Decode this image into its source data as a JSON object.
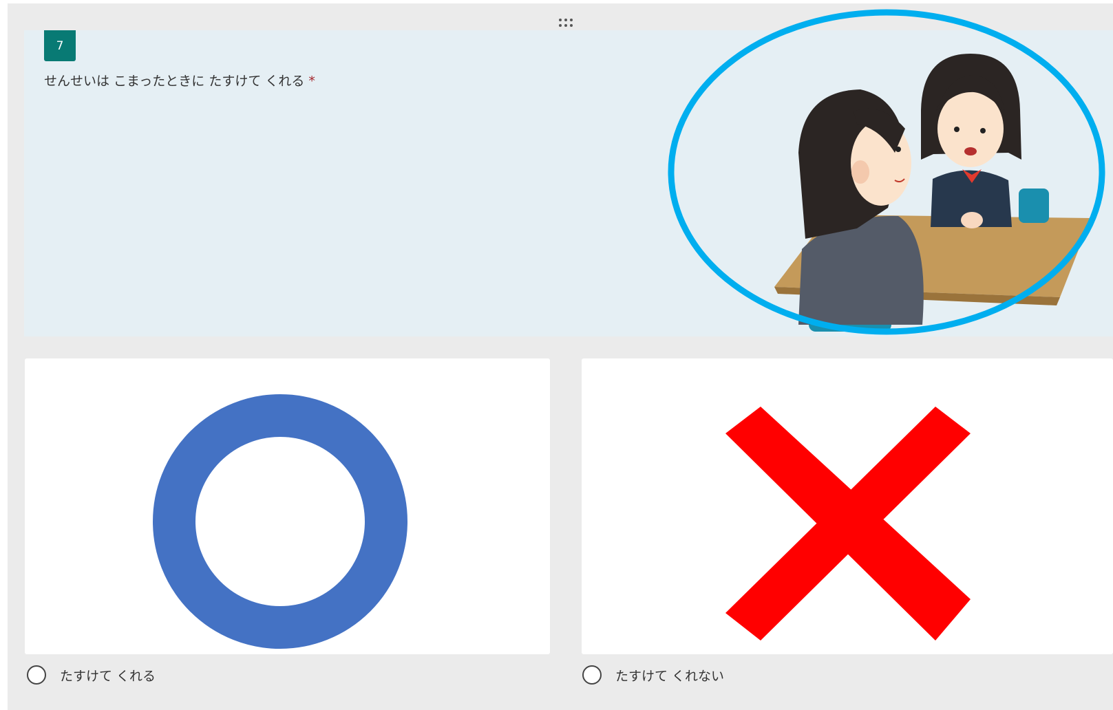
{
  "question": {
    "number": "7",
    "title": "せんせいは こまったときに たすけて くれる",
    "required_mark": "*",
    "image_icon": "teacher-student-illustration"
  },
  "options": [
    {
      "label": "たすけて くれる",
      "image_icon": "blue-circle-maru",
      "color": "#4472c4",
      "selected": false
    },
    {
      "label": "たすけて くれない",
      "image_icon": "red-x-batsu",
      "color": "#ff0000",
      "selected": false
    }
  ],
  "colors": {
    "question_number_badge": "#087a74",
    "highlight_ellipse": "#00aeef",
    "question_background": "#e5eff4",
    "card_background": "#ebebeb"
  },
  "icons": {
    "drag_handle": "drag-handle-icon"
  }
}
